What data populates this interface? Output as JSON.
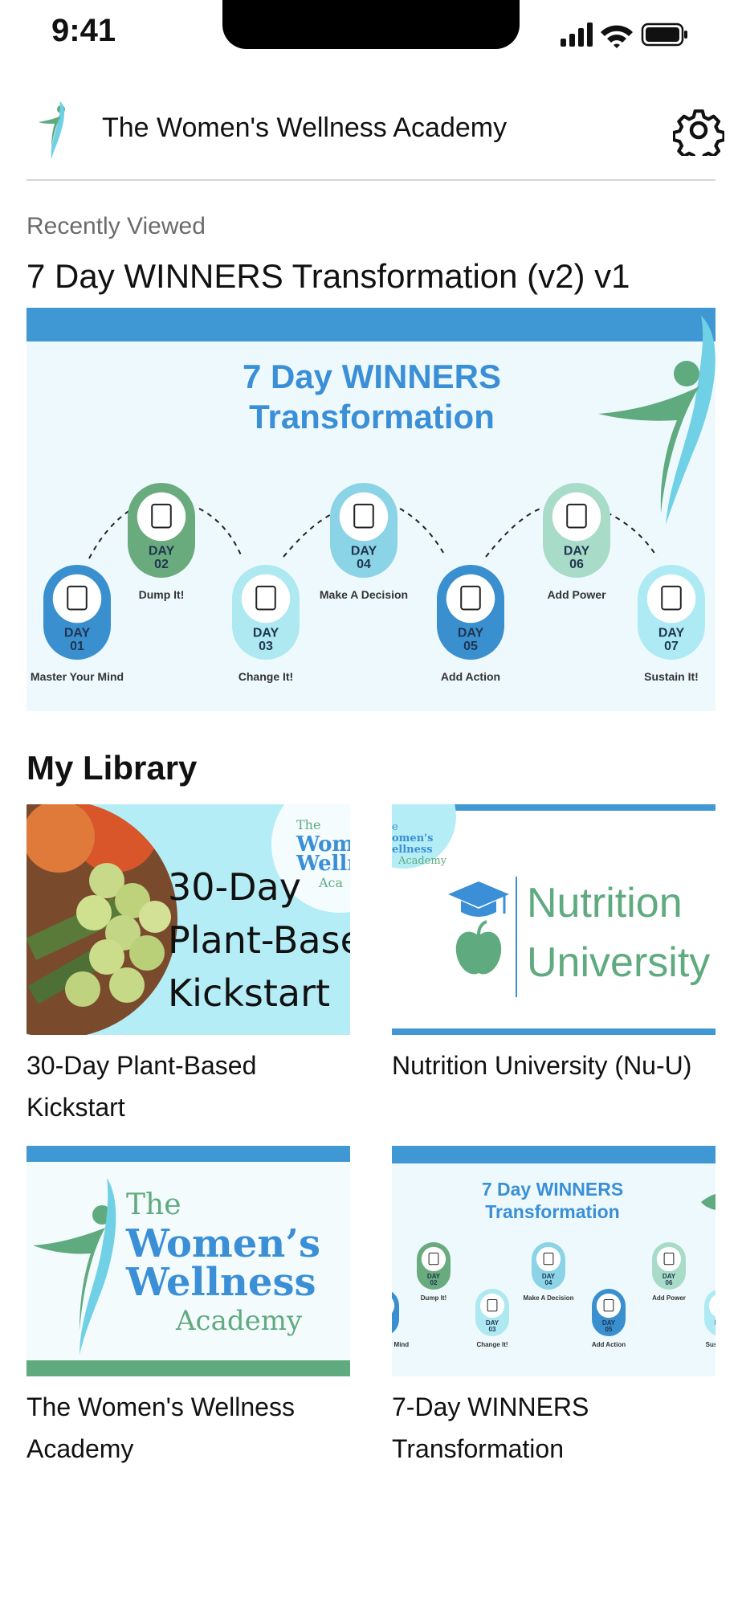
{
  "status_bar": {
    "time": "9:41",
    "icons": [
      "signal-icon",
      "wifi-icon",
      "battery-icon"
    ]
  },
  "header": {
    "title": "The Women's Wellness Academy",
    "settings_icon": "gear-icon"
  },
  "recently_viewed": {
    "label": "Recently Viewed",
    "title": "7 Day WINNERS Transformation (v2) v1",
    "banner": {
      "heading_line1": "7 Day WINNERS",
      "heading_line2": "Transformation",
      "days": [
        {
          "day_label": "DAY",
          "num": "01",
          "caption": "Master Your Mind",
          "color": "#3a8fcf"
        },
        {
          "day_label": "DAY",
          "num": "02",
          "caption": "Dump It!",
          "color": "#6aab7e"
        },
        {
          "day_label": "DAY",
          "num": "03",
          "caption": "Change It!",
          "color": "#aee8f1"
        },
        {
          "day_label": "DAY",
          "num": "04",
          "caption": "Make A Decision",
          "color": "#8bd3e6"
        },
        {
          "day_label": "DAY",
          "num": "05",
          "caption": "Add Action",
          "color": "#3a8fcf"
        },
        {
          "day_label": "DAY",
          "num": "06",
          "caption": "Add Power",
          "color": "#a8dbc8"
        },
        {
          "day_label": "DAY",
          "num": "07",
          "caption": "Sustain It!",
          "color": "#aeeaf3"
        }
      ]
    }
  },
  "library": {
    "title": "My Library",
    "items": [
      {
        "label": "30-Day Plant-Based Kickstart",
        "thumb_lines": [
          "30-Day",
          "Plant-Base",
          "Kickstart"
        ],
        "badge_lines": [
          "The",
          "Wome",
          "Welln",
          "Aca"
        ]
      },
      {
        "label": "Nutrition University (Nu-U)",
        "thumb_lines": [
          "Nutrition",
          "University"
        ],
        "badge_lines": [
          "e",
          "omen's",
          "ellness",
          "Academy"
        ]
      },
      {
        "label": "The Women's Wellness Academy",
        "thumb_lines": [
          "The",
          "Women’s",
          "Wellness",
          "Academy"
        ]
      },
      {
        "label": "7-Day WINNERS Transformation",
        "thumb_lines": [
          "7 Day WINNERS",
          "Transformation"
        ]
      }
    ]
  },
  "colors": {
    "brand_blue": "#3f97d3",
    "brand_green": "#5faa7f",
    "light_cyan": "#b5edf7",
    "heading_blue": "#3a8fd6"
  }
}
